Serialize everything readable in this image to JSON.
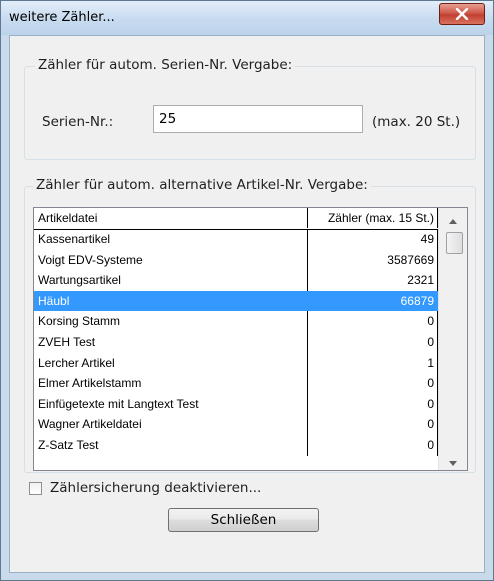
{
  "window": {
    "title": "weitere Zähler...",
    "close_icon": "close-x-icon"
  },
  "serial_group": {
    "title": "Zähler für autom. Serien-Nr. Vergabe:",
    "label": "Serien-Nr.:",
    "value": "25",
    "hint": "(max. 20 St.)"
  },
  "article_group": {
    "title": "Zähler für autom. alternative Artikel-Nr. Vergabe:",
    "columns": [
      "Artikeldatei",
      "Zähler (max. 15 St.)"
    ],
    "rows": [
      {
        "name": "Kassenartikel",
        "count": "49"
      },
      {
        "name": "Voigt EDV-Systeme",
        "count": "3587669"
      },
      {
        "name": "Wartungsartikel",
        "count": "2321"
      },
      {
        "name": "Häubl",
        "count": "66879",
        "selected": true
      },
      {
        "name": "Korsing Stamm",
        "count": "0"
      },
      {
        "name": "ZVEH Test",
        "count": "0"
      },
      {
        "name": "Lercher Artikel",
        "count": "1"
      },
      {
        "name": "Elmer Artikelstamm",
        "count": "0"
      },
      {
        "name": "Einfügetexte mit Langtext Test",
        "count": "0"
      },
      {
        "name": "Wagner Artikeldatei",
        "count": "0"
      },
      {
        "name": "Z-Satz Test",
        "count": "0"
      }
    ]
  },
  "checkbox": {
    "label": "Zählersicherung deaktivieren...",
    "checked": false
  },
  "close_button": {
    "label": "Schließen"
  },
  "colors": {
    "selection": "#3399ff",
    "close_button": "#c13f30",
    "window_frame": "#c9daea"
  }
}
